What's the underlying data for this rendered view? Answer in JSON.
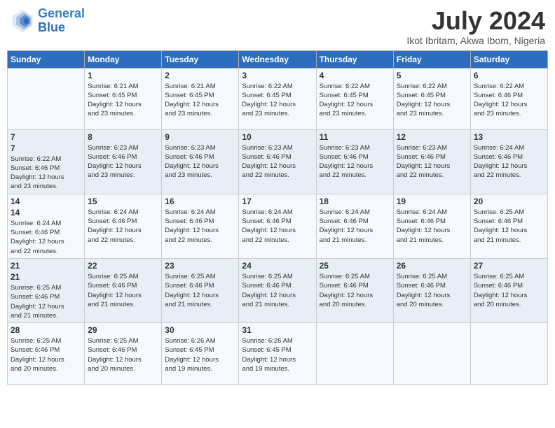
{
  "header": {
    "logo_line1": "General",
    "logo_line2": "Blue",
    "month_year": "July 2024",
    "location": "Ikot Ibritam, Akwa Ibom, Nigeria"
  },
  "weekdays": [
    "Sunday",
    "Monday",
    "Tuesday",
    "Wednesday",
    "Thursday",
    "Friday",
    "Saturday"
  ],
  "weeks": [
    [
      {
        "day": "",
        "info": ""
      },
      {
        "day": "1",
        "info": "Sunrise: 6:21 AM\nSunset: 6:45 PM\nDaylight: 12 hours\nand 23 minutes."
      },
      {
        "day": "2",
        "info": "Sunrise: 6:21 AM\nSunset: 6:45 PM\nDaylight: 12 hours\nand 23 minutes."
      },
      {
        "day": "3",
        "info": "Sunrise: 6:22 AM\nSunset: 6:45 PM\nDaylight: 12 hours\nand 23 minutes."
      },
      {
        "day": "4",
        "info": "Sunrise: 6:22 AM\nSunset: 6:45 PM\nDaylight: 12 hours\nand 23 minutes."
      },
      {
        "day": "5",
        "info": "Sunrise: 6:22 AM\nSunset: 6:45 PM\nDaylight: 12 hours\nand 23 minutes."
      },
      {
        "day": "6",
        "info": "Sunrise: 6:22 AM\nSunset: 6:46 PM\nDaylight: 12 hours\nand 23 minutes."
      }
    ],
    [
      {
        "day": "7",
        "info": ""
      },
      {
        "day": "8",
        "info": "Sunrise: 6:23 AM\nSunset: 6:46 PM\nDaylight: 12 hours\nand 23 minutes."
      },
      {
        "day": "9",
        "info": "Sunrise: 6:23 AM\nSunset: 6:46 PM\nDaylight: 12 hours\nand 23 minutes."
      },
      {
        "day": "10",
        "info": "Sunrise: 6:23 AM\nSunset: 6:46 PM\nDaylight: 12 hours\nand 22 minutes."
      },
      {
        "day": "11",
        "info": "Sunrise: 6:23 AM\nSunset: 6:46 PM\nDaylight: 12 hours\nand 22 minutes."
      },
      {
        "day": "12",
        "info": "Sunrise: 6:23 AM\nSunset: 6:46 PM\nDaylight: 12 hours\nand 22 minutes."
      },
      {
        "day": "13",
        "info": "Sunrise: 6:24 AM\nSunset: 6:46 PM\nDaylight: 12 hours\nand 22 minutes."
      }
    ],
    [
      {
        "day": "14",
        "info": ""
      },
      {
        "day": "15",
        "info": "Sunrise: 6:24 AM\nSunset: 6:46 PM\nDaylight: 12 hours\nand 22 minutes."
      },
      {
        "day": "16",
        "info": "Sunrise: 6:24 AM\nSunset: 6:46 PM\nDaylight: 12 hours\nand 22 minutes."
      },
      {
        "day": "17",
        "info": "Sunrise: 6:24 AM\nSunset: 6:46 PM\nDaylight: 12 hours\nand 22 minutes."
      },
      {
        "day": "18",
        "info": "Sunrise: 6:24 AM\nSunset: 6:46 PM\nDaylight: 12 hours\nand 21 minutes."
      },
      {
        "day": "19",
        "info": "Sunrise: 6:24 AM\nSunset: 6:46 PM\nDaylight: 12 hours\nand 21 minutes."
      },
      {
        "day": "20",
        "info": "Sunrise: 6:25 AM\nSunset: 6:46 PM\nDaylight: 12 hours\nand 21 minutes."
      }
    ],
    [
      {
        "day": "21",
        "info": ""
      },
      {
        "day": "22",
        "info": "Sunrise: 6:25 AM\nSunset: 6:46 PM\nDaylight: 12 hours\nand 21 minutes."
      },
      {
        "day": "23",
        "info": "Sunrise: 6:25 AM\nSunset: 6:46 PM\nDaylight: 12 hours\nand 21 minutes."
      },
      {
        "day": "24",
        "info": "Sunrise: 6:25 AM\nSunset: 6:46 PM\nDaylight: 12 hours\nand 21 minutes."
      },
      {
        "day": "25",
        "info": "Sunrise: 6:25 AM\nSunset: 6:46 PM\nDaylight: 12 hours\nand 20 minutes."
      },
      {
        "day": "26",
        "info": "Sunrise: 6:25 AM\nSunset: 6:46 PM\nDaylight: 12 hours\nand 20 minutes."
      },
      {
        "day": "27",
        "info": "Sunrise: 6:25 AM\nSunset: 6:46 PM\nDaylight: 12 hours\nand 20 minutes."
      }
    ],
    [
      {
        "day": "28",
        "info": "Sunrise: 6:25 AM\nSunset: 6:46 PM\nDaylight: 12 hours\nand 20 minutes."
      },
      {
        "day": "29",
        "info": "Sunrise: 6:25 AM\nSunset: 6:46 PM\nDaylight: 12 hours\nand 20 minutes."
      },
      {
        "day": "30",
        "info": "Sunrise: 6:26 AM\nSunset: 6:45 PM\nDaylight: 12 hours\nand 19 minutes."
      },
      {
        "day": "31",
        "info": "Sunrise: 6:26 AM\nSunset: 6:45 PM\nDaylight: 12 hours\nand 19 minutes."
      },
      {
        "day": "",
        "info": ""
      },
      {
        "day": "",
        "info": ""
      },
      {
        "day": "",
        "info": ""
      }
    ]
  ],
  "week1_sun_info": "Sunrise: 6:22 AM\nSunset: 6:45 PM\nDaylight: 12 hours\nand 23 minutes.",
  "week2_sun_info": "Sunrise: 6:22 AM\nSunset: 6:46 PM\nDaylight: 12 hours\nand 23 minutes.",
  "week3_sun_info": "Sunrise: 6:24 AM\nSunset: 6:46 PM\nDaylight: 12 hours\nand 22 minutes.",
  "week4_sun_info": "Sunrise: 6:25 AM\nSunset: 6:46 PM\nDaylight: 12 hours\nand 21 minutes."
}
